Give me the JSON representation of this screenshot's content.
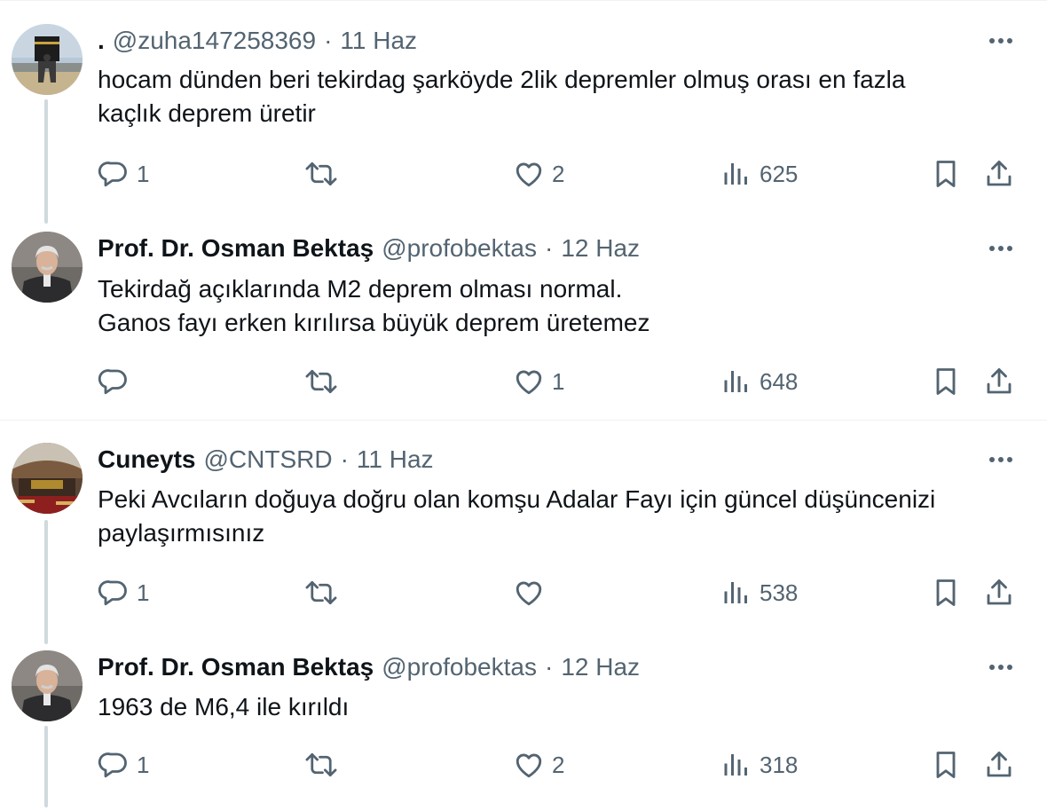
{
  "tweets": [
    {
      "name": ".",
      "handle": "@zuha147258369",
      "sep": "·",
      "date": "11 Haz",
      "text_lines": [
        "hocam dünden beri tekirdag şarköyde 2lik depremler olmuş orası en fazla",
        "kaçlık deprem üretir"
      ],
      "replies": "1",
      "retweets": "",
      "likes": "2",
      "views": "625"
    },
    {
      "name": "Prof. Dr. Osman Bektaş",
      "handle": "@profobektas",
      "sep": "·",
      "date": "12 Haz",
      "text_lines": [
        "Tekirdağ açıklarında M2 deprem olması normal.",
        "Ganos fayı erken kırılırsa büyük deprem üretemez"
      ],
      "replies": "",
      "retweets": "",
      "likes": "1",
      "views": "648"
    },
    {
      "name": "Cuneyts",
      "handle": "@CNTSRD",
      "sep": "·",
      "date": "11 Haz",
      "text_lines": [
        "Peki Avcıların doğuya doğru olan komşu Adalar Fayı için güncel düşüncenizi",
        "paylaşırmısınız"
      ],
      "replies": "1",
      "retweets": "",
      "likes": "",
      "views": "538"
    },
    {
      "name": "Prof. Dr. Osman Bektaş",
      "handle": "@profobektas",
      "sep": "·",
      "date": "12 Haz",
      "text_lines": [
        "1963 de M6,4 ile kırıldı"
      ],
      "replies": "1",
      "retweets": "",
      "likes": "2",
      "views": "318"
    }
  ],
  "icons": {
    "reply": "reply-icon",
    "retweet": "retweet-icon",
    "like": "heart-icon",
    "views": "views-icon",
    "bookmark": "bookmark-icon",
    "share": "share-icon",
    "more": "more-icon"
  },
  "colors": {
    "text": "#0f1419",
    "secondary": "#536471",
    "border": "#eff3f4",
    "thread_line": "#cfd9de"
  }
}
